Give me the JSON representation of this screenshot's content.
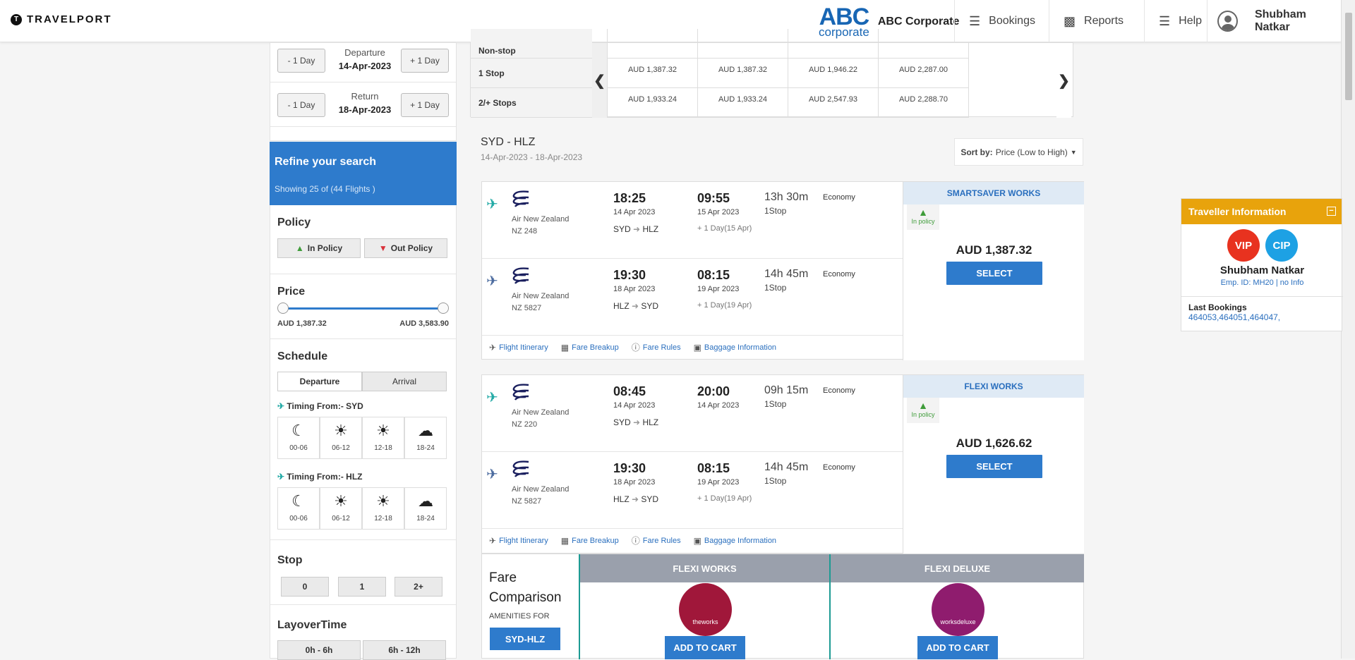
{
  "header": {
    "logo": "TRAVELPORT",
    "logo_mark": "T",
    "corp_logo_top": "ABC",
    "corp_logo_bottom": "corporate",
    "corp_name": "ABC Corporate",
    "nav": [
      {
        "label": "Bookings",
        "icon": "briefcase-icon"
      },
      {
        "label": "Reports",
        "icon": "bar-chart-icon"
      },
      {
        "label": "Help",
        "icon": "help-icon"
      }
    ],
    "user": "Shubham Natkar"
  },
  "dates": {
    "minus": "- 1 Day",
    "plus": "+ 1 Day",
    "departure_label": "Departure",
    "departure_date": "14-Apr-2023",
    "return_label": "Return",
    "return_date": "18-Apr-2023"
  },
  "refine": {
    "title": "Refine your search",
    "showing": "Showing 25 of (44 Flights )"
  },
  "filters": {
    "policy_title": "Policy",
    "in_policy": "In Policy",
    "out_policy": "Out Policy",
    "price_title": "Price",
    "price_min": "AUD 1,387.32",
    "price_max": "AUD 3,583.90",
    "schedule_title": "Schedule",
    "departure_tab": "Departure",
    "arrival_tab": "Arrival",
    "timing1": "Timing From:- SYD",
    "timing2": "Timing From:- HLZ",
    "slots": [
      "00-06",
      "06-12",
      "12-18",
      "18-24"
    ],
    "stop_title": "Stop",
    "stops": [
      "0",
      "1",
      "2+"
    ],
    "layover_title": "LayoverTime",
    "layovers": [
      "0h - 6h",
      "6h - 12h"
    ]
  },
  "matrix": {
    "rows": [
      {
        "label": "Non-stop",
        "values": [
          "",
          "",
          "",
          ""
        ]
      },
      {
        "label": "1 Stop",
        "values": [
          "AUD 1,387.32",
          "AUD 1,387.32",
          "AUD 1,946.22",
          "AUD 2,287.00"
        ]
      },
      {
        "label": "2/+ Stops",
        "values": [
          "AUD 1,933.24",
          "AUD 1,933.24",
          "AUD 2,547.93",
          "AUD 2,288.70"
        ]
      }
    ]
  },
  "route": {
    "title": "SYD - HLZ",
    "dates": "14-Apr-2023  - 18-Apr-2023"
  },
  "sort": {
    "label": "Sort by:",
    "value": "Price (Low to High)"
  },
  "results": [
    {
      "fare_name": "SMARTSAVER WORKS",
      "policy": "In policy",
      "price": "AUD 1,387.32",
      "select": "SELECT",
      "legs": [
        {
          "airline": "Air New Zealand",
          "flight": "NZ  248",
          "dep_time": "18:25",
          "dep_date": "14 Apr 2023",
          "arr_time": "09:55",
          "arr_date": "15 Apr 2023",
          "from": "SYD",
          "to": "HLZ",
          "next_day": "+ 1 Day(15 Apr)",
          "duration": "13h 30m",
          "stops": "1Stop",
          "cabin": "Economy"
        },
        {
          "airline": "Air New Zealand",
          "flight": "NZ  5827",
          "dep_time": "19:30",
          "dep_date": "18 Apr 2023",
          "arr_time": "08:15",
          "arr_date": "19 Apr 2023",
          "from": "HLZ",
          "to": "SYD",
          "next_day": "+ 1 Day(19 Apr)",
          "duration": "14h 45m",
          "stops": "1Stop",
          "cabin": "Economy"
        }
      ]
    },
    {
      "fare_name": "FLEXI WORKS",
      "policy": "In policy",
      "price": "AUD 1,626.62",
      "select": "SELECT",
      "legs": [
        {
          "airline": "Air New Zealand",
          "flight": "NZ  220",
          "dep_time": "08:45",
          "dep_date": "14 Apr 2023",
          "arr_time": "20:00",
          "arr_date": "14 Apr 2023",
          "from": "SYD",
          "to": "HLZ",
          "next_day": "",
          "duration": "09h 15m",
          "stops": "1Stop",
          "cabin": "Economy"
        },
        {
          "airline": "Air New Zealand",
          "flight": "NZ  5827",
          "dep_time": "19:30",
          "dep_date": "18 Apr 2023",
          "arr_time": "08:15",
          "arr_date": "19 Apr 2023",
          "from": "HLZ",
          "to": "SYD",
          "next_day": "+ 1 Day(19 Apr)",
          "duration": "14h 45m",
          "stops": "1Stop",
          "cabin": "Economy"
        }
      ]
    }
  ],
  "links": [
    "Flight Itinerary",
    "Fare Breakup",
    "Fare Rules",
    "Baggage Information"
  ],
  "fare_comparison": {
    "title_line1": "Fare",
    "title_line2": "Comparison",
    "amenities": "AMENITIES FOR",
    "route": "SYD-HLZ",
    "columns": [
      {
        "name": "FLEXI WORKS",
        "badge": "theworks",
        "color": "#a0173a",
        "button": "ADD TO CART"
      },
      {
        "name": "FLEXI DELUXE",
        "badge": "worksdeluxe",
        "color": "#8f1c6e",
        "button": "ADD TO CART"
      }
    ]
  },
  "traveller": {
    "title": "Traveller Information",
    "vip": "VIP",
    "cip": "CIP",
    "name": "Shubham Natkar",
    "emp": "Emp. ID: MH20 | no Info",
    "last_label": "Last Bookings",
    "last_values": "464053,464051,464047,"
  }
}
